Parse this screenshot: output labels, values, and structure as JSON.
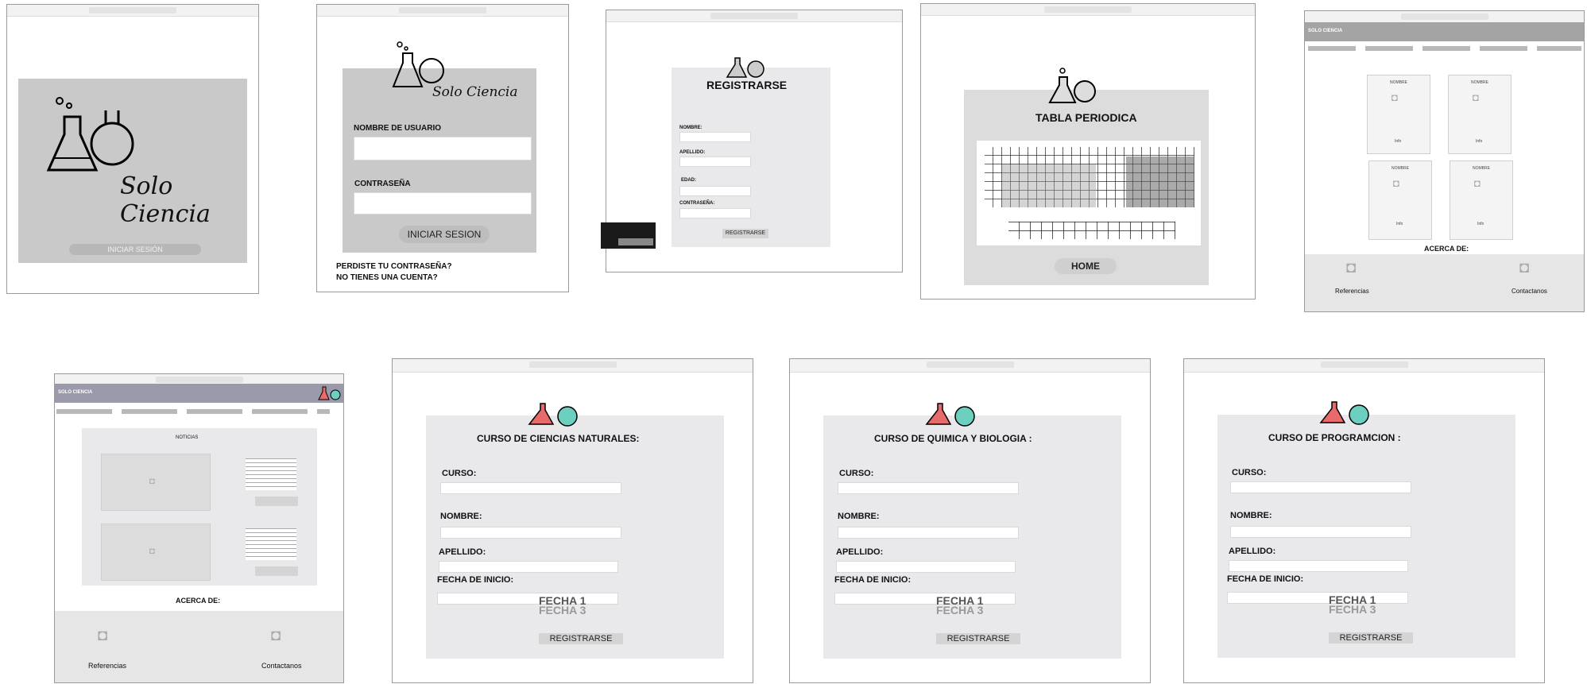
{
  "screens": {
    "landing": {
      "logo_text": "Solo Ciencia",
      "login_button": "INICIAR SESIÓN"
    },
    "login": {
      "logo_text": "Solo Ciencia",
      "username_label": "NOMBRE DE USUARIO",
      "password_label": "CONTRASEÑA",
      "login_button": "INICIAR SESION",
      "forgot_link": "PERDISTE TU CONTRASEÑA?",
      "no_account_link": "NO TIENES UNA CUENTA?"
    },
    "register": {
      "title": "REGISTRARSE",
      "fields": [
        "NOMBRE:",
        "APELLIDO:",
        "EDAD:",
        "CONTRASEÑA:"
      ],
      "submit": "REGISTRARSE"
    },
    "periodic": {
      "title": "TABLA PERIODICA",
      "home_button": "HOME"
    },
    "home": {
      "brand": "SOLO CIENCIA",
      "card_title": "NOMBRE",
      "card_info": "Info",
      "about": "ACERCA DE:",
      "references": "Referencias",
      "contact": "Contactanos"
    },
    "news": {
      "brand": "SOLO CIENCIA",
      "section_title": "NOTICIAS",
      "about": "ACERCA DE:",
      "references": "Referencias",
      "contact": "Contactanos"
    },
    "course_forms": [
      {
        "title": "CURSO DE CIENCIAS NATURALES:"
      },
      {
        "title": "CURSO DE QUIMICA Y BIOLOGIA :"
      },
      {
        "title": "CURSO DE PROGRAMCION :"
      }
    ],
    "course_form_common": {
      "course_label": "CURSO:",
      "name_label": "NOMBRE:",
      "lastname_label": "APELLIDO:",
      "start_label": "FECHA DE INICIO:",
      "date_option": "FECHA 1",
      "date_option_2": "FECHA 3",
      "submit": "REGISTRARSE"
    }
  },
  "colors": {
    "panel": "#e9e9ec",
    "flask_red": "#e86a6a",
    "flask_teal": "#6ccfc0"
  }
}
